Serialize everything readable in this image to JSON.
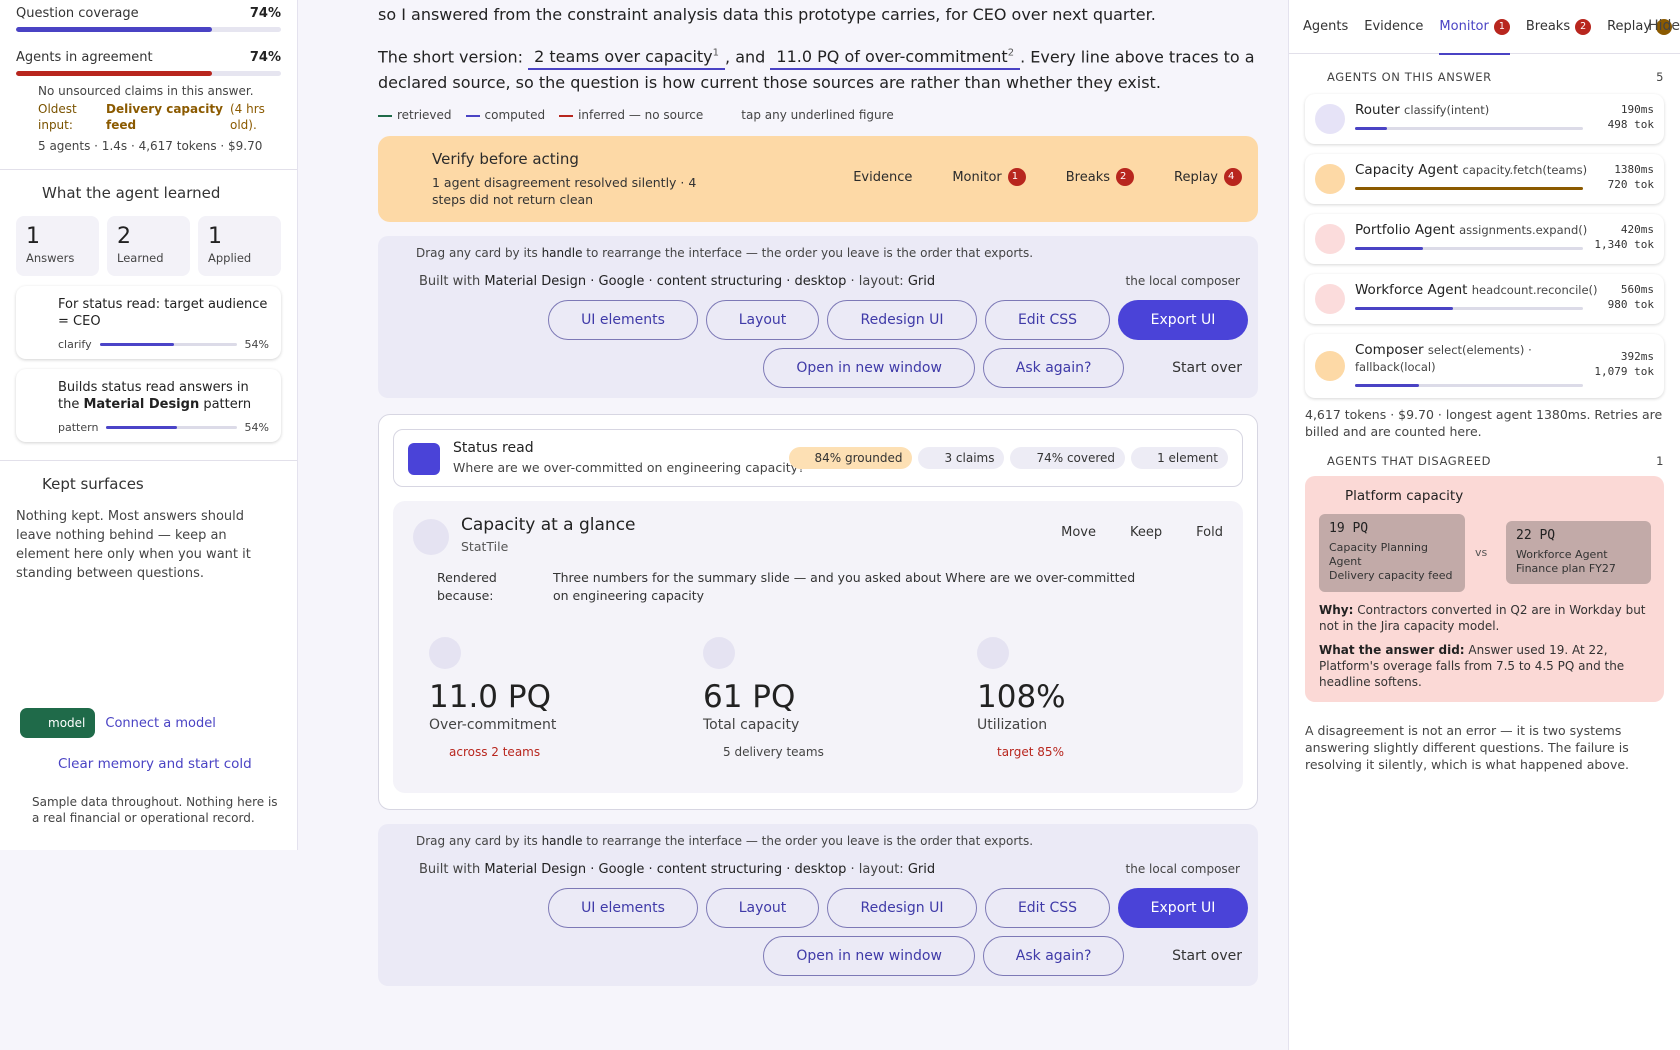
{
  "left": {
    "coverage": {
      "label": "Question coverage",
      "value": "74%",
      "fraction": 0.74,
      "color": "#4a43c4"
    },
    "agreement": {
      "label": "Agents in agreement",
      "value": "74%",
      "fraction": 0.74,
      "color": "#b8261e"
    },
    "unsourced": "No unsourced claims in this answer.",
    "oldest": {
      "key": "Oldest input:",
      "source": "Delivery capacity feed",
      "age": "(4 hrs old)."
    },
    "stats": "5 agents · 1.4s · 4,617 tokens · $9.70",
    "learned_title": "What the agent learned",
    "tiles": [
      {
        "n": "1",
        "label": "Answers"
      },
      {
        "n": "2",
        "label": "Learned"
      },
      {
        "n": "1",
        "label": "Applied"
      }
    ],
    "learn_cards": [
      {
        "text": "For status read: target audience = CEO",
        "tag": "clarify",
        "pct": "54%",
        "fraction": 0.54
      },
      {
        "text_a": "Builds status read answers in the ",
        "text_b": "Material Design",
        "text_c": " pattern",
        "tag": "pattern",
        "pct": "54%",
        "fraction": 0.54
      }
    ],
    "kept_title": "Kept surfaces",
    "kept_text": "Nothing kept. Most answers should leave nothing behind — keep an element here only when you want it standing between questions.",
    "model_pill": "model",
    "connect": "Connect a model",
    "clear": "Clear memory and start cold",
    "sample": "Sample data throughout. Nothing here is a real financial or operational record."
  },
  "center": {
    "intro": "so I answered from the constraint analysis data this prototype carries, for CEO over next quarter.",
    "short_prefix": "The short version:",
    "fig1": "2 teams over capacity",
    "fig1_sup": "1",
    "and": ", and",
    "fig2": "11.0 PQ of over-commitment",
    "fig2_sup": "2",
    "short_suffix": ". Every line above traces to a declared source, so the question is how current those sources are rather than whether they exist.",
    "legend": {
      "retrieved": "retrieved",
      "computed": "computed",
      "inferred": "inferred — no source",
      "tap": "tap any underlined figure",
      "colors": {
        "retrieved": "#1f6a49",
        "computed": "#4a43c4",
        "inferred": "#b8261e"
      }
    },
    "verify": {
      "title": "Verify before acting",
      "sub": "1 agent disagreement resolved silently · 4 steps did not return clean",
      "evidence": "Evidence",
      "monitor": "Monitor",
      "monitor_n": "1",
      "breaks": "Breaks",
      "breaks_n": "2",
      "replay": "Replay",
      "replay_n": "4"
    },
    "composer": {
      "hint_a": "Drag any card by its ",
      "hint_b": "handle",
      "hint_c": " to rearrange the interface — the order you leave is the order that exports.",
      "built_a": "Built with ",
      "built_b": "Material Design · Google · content structuring · desktop",
      "built_c": " · layout: ",
      "built_d": "Grid",
      "local": "the local composer",
      "ui_elements": "UI elements",
      "layout": "Layout",
      "redesign": "Redesign UI",
      "edit_css": "Edit CSS",
      "export": "Export UI",
      "open_new": "Open in new window",
      "ask_again": "Ask again?",
      "start_over": "Start over"
    },
    "status": {
      "title": "Status read",
      "question": "Where are we over-committed on engineering capacity?",
      "chips": [
        "84% grounded",
        "3 claims",
        "74% covered",
        "1 element"
      ]
    },
    "capcard": {
      "title": "Capacity at a glance",
      "subtitle": "StatTile",
      "move": "Move",
      "keep": "Keep",
      "fold": "Fold",
      "rendered_label": "Rendered because:",
      "rendered_text": "Three numbers for the summary slide — and you asked about Where are we over-committed on engineering capacity",
      "metrics": [
        {
          "value": "11.0 PQ",
          "label": "Over-commitment",
          "note": "across 2 teams",
          "note_color": "#b8261e"
        },
        {
          "value": "61 PQ",
          "label": "Total capacity",
          "note": "5 delivery teams",
          "note_color": "#444444"
        },
        {
          "value": "108%",
          "label": "Utilization",
          "note": "target 85%",
          "note_color": "#b8261e"
        }
      ]
    }
  },
  "right": {
    "tabs": {
      "agents": "Agents",
      "evidence": "Evidence",
      "monitor": "Monitor",
      "monitor_n": "1",
      "breaks": "Breaks",
      "breaks_n": "2",
      "replay": "Replay",
      "hide": "Hide"
    },
    "agents_title": "AGENTS ON THIS ANSWER",
    "agents_count": "5",
    "agents": [
      {
        "name": "Router",
        "call": "classify(intent)",
        "ms": "190ms",
        "tok": "498 tok",
        "fraction": 0.14,
        "bar": "#4a43c4",
        "avatar": "#e6e3f7"
      },
      {
        "name": "Capacity Agent",
        "call": "capacity.fetch(teams)",
        "ms": "1380ms",
        "tok": "720 tok",
        "fraction": 1.0,
        "bar": "#8b5a00",
        "avatar": "#fdd9a6"
      },
      {
        "name": "Portfolio Agent",
        "call": "assignments.expand()",
        "ms": "420ms",
        "tok": "1,340 tok",
        "fraction": 0.3,
        "bar": "#4a43c4",
        "avatar": "#fbdcdc"
      },
      {
        "name": "Workforce Agent",
        "call": "headcount.reconcile()",
        "ms": "560ms",
        "tok": "980 tok",
        "fraction": 0.43,
        "bar": "#4a43c4",
        "avatar": "#fbdcdc"
      },
      {
        "name": "Composer",
        "call": "select(elements) · fallback(local)",
        "ms": "392ms",
        "tok": "1,079 tok",
        "fraction": 0.28,
        "bar": "#4a43c4",
        "avatar": "#fdd9a6"
      }
    ],
    "tokens_note": "4,617 tokens · $9.70 · longest agent 1380ms. Retries are billed and are counted here.",
    "disagreed_title": "AGENTS THAT DISAGREED",
    "disagreed_count": "1",
    "disagree": {
      "title": "Platform capacity",
      "left_value": "19 PQ",
      "left_src1": "Capacity Planning Agent",
      "left_src2": "Delivery capacity feed",
      "vs": "vs",
      "right_value": "22 PQ",
      "right_src1": "Workforce Agent",
      "right_src2": "Finance plan FY27",
      "why_label": "Why:",
      "why": "Contractors converted in Q2 are in Workday but not in the Jira capacity model.",
      "did_label": "What the answer did:",
      "did": "Answer used 19. At 22, Platform's overage falls from 7.5 to 4.5 PQ and the headline softens."
    },
    "footer": "A disagreement is not an error — it is two systems answering slightly different questions. The failure is resolving it silently, which is what happened above."
  }
}
